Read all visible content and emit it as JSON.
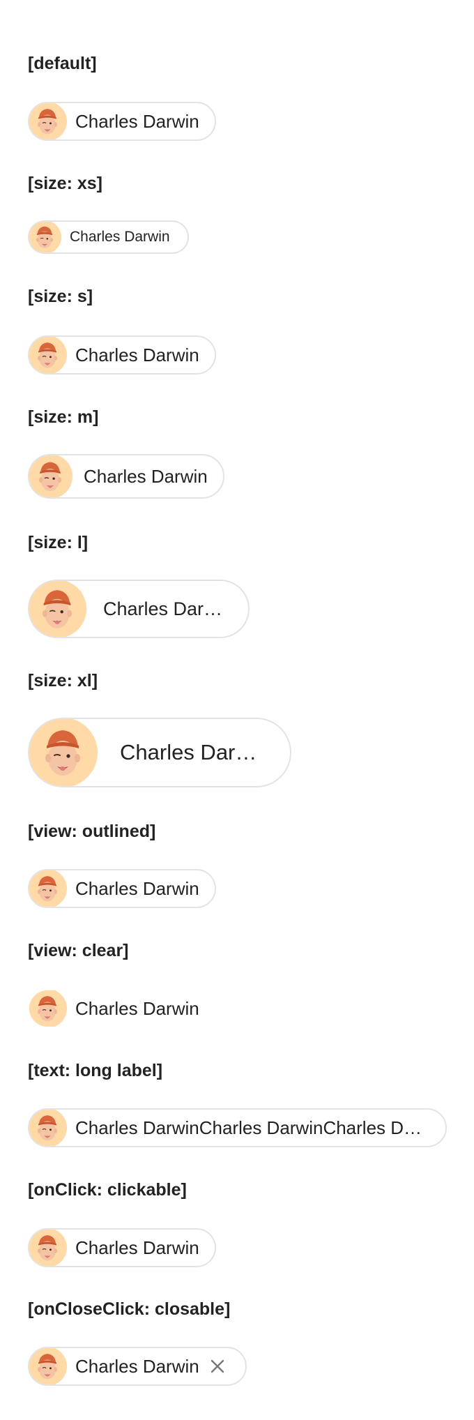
{
  "sections": {
    "default": {
      "heading": "[default]",
      "label": "Charles Darwin"
    },
    "size_xs": {
      "heading": "[size: xs]",
      "label": "Charles Darwin"
    },
    "size_s": {
      "heading": "[size: s]",
      "label": "Charles Darwin"
    },
    "size_m": {
      "heading": "[size: m]",
      "label": "Charles Darwin"
    },
    "size_l": {
      "heading": "[size: l]",
      "label": "Charles Darwin"
    },
    "size_xl": {
      "heading": "[size: xl]",
      "label": "Charles Darwin"
    },
    "view_outlined": {
      "heading": "[view: outlined]",
      "label": "Charles Darwin"
    },
    "view_clear": {
      "heading": "[view: clear]",
      "label": "Charles Darwin"
    },
    "text_long": {
      "heading": "[text: long label]",
      "label": "Charles DarwinCharles DarwinCharles DarwinCharles Darwin"
    },
    "clickable": {
      "heading": "[onClick: clickable]",
      "label": "Charles Darwin"
    },
    "closable": {
      "heading": "[onCloseClick: closable]",
      "label": "Charles Darwin"
    }
  },
  "avatar_icon": "memoji-avatar-icon",
  "close_icon": "close-icon",
  "colors": {
    "border": "#e3e3e3",
    "avatar_bg": "#ffd9a6",
    "text": "#222222"
  }
}
